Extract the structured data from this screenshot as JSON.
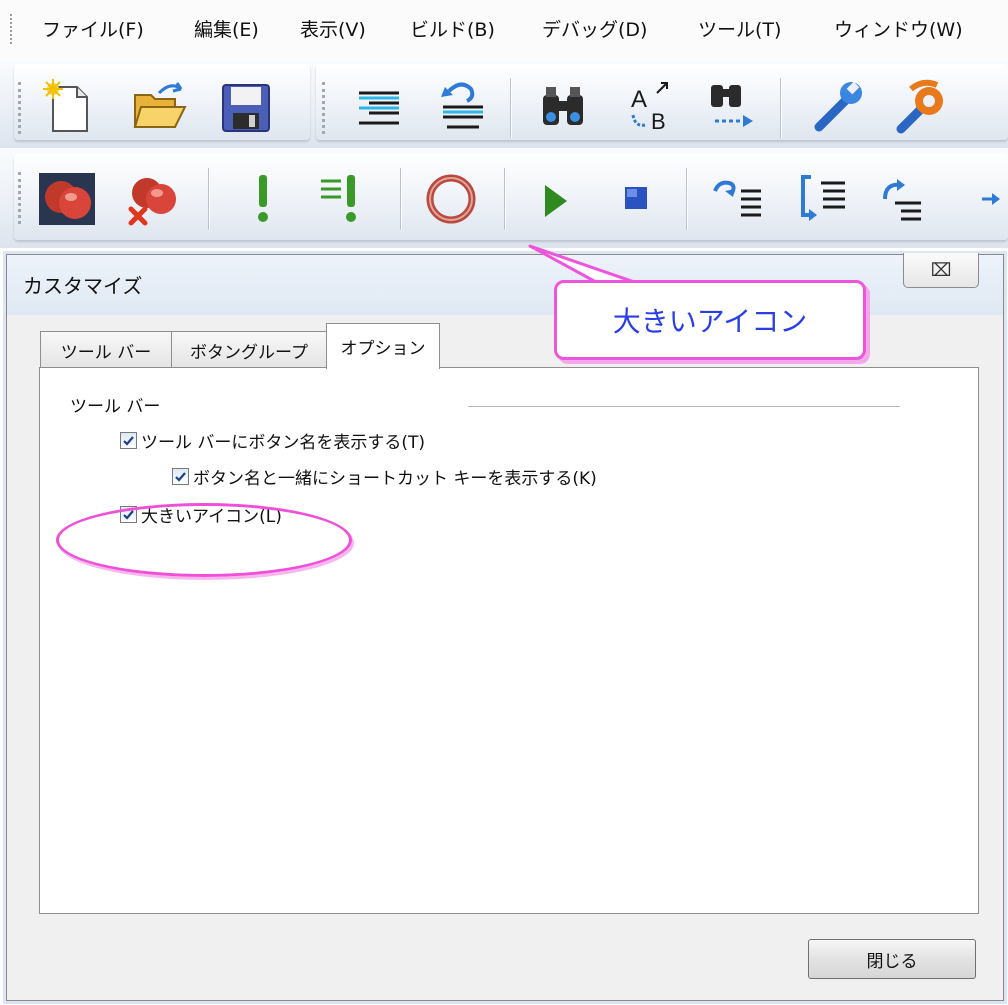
{
  "menubar": {
    "items": [
      "ファイル(F)",
      "編集(E)",
      "表示(V)",
      "ビルド(B)",
      "デバッグ(D)",
      "ツール(T)",
      "ウィンドウ(W)"
    ]
  },
  "toolbar1": {
    "buttons": [
      "new-file-icon",
      "open-folder-icon",
      "save-icon",
      "indent-icon",
      "unindent-icon",
      "find-icon",
      "replace-icon",
      "find-in-files-icon",
      "wrench-icon",
      "tools-icon"
    ]
  },
  "toolbar2": {
    "buttons": [
      "breakpoint-icon",
      "remove-breakpoint-icon",
      "exclamation-icon",
      "multi-exclamation-icon",
      "circle-icon",
      "play-icon",
      "stop-icon",
      "step-over-icon",
      "step-into-icon",
      "step-out-icon"
    ]
  },
  "dialog": {
    "title": "カスタマイズ",
    "close_symbol": "⌧",
    "tabs": [
      "ツール バー",
      "ボタングループ",
      "オプション"
    ],
    "group_label": "ツール バー",
    "options": [
      {
        "label": "ツール バーにボタン名を表示する(T)",
        "checked": true
      },
      {
        "label": "ボタン名と一緒にショートカット キーを表示する(K)",
        "checked": true
      },
      {
        "label": "大きいアイコン(L)",
        "checked": true
      }
    ],
    "close_button": "閉じる"
  },
  "annotation": {
    "callout_text": "大きいアイコン",
    "color": "#ee55dd",
    "text_color": "#2a3ee8"
  }
}
